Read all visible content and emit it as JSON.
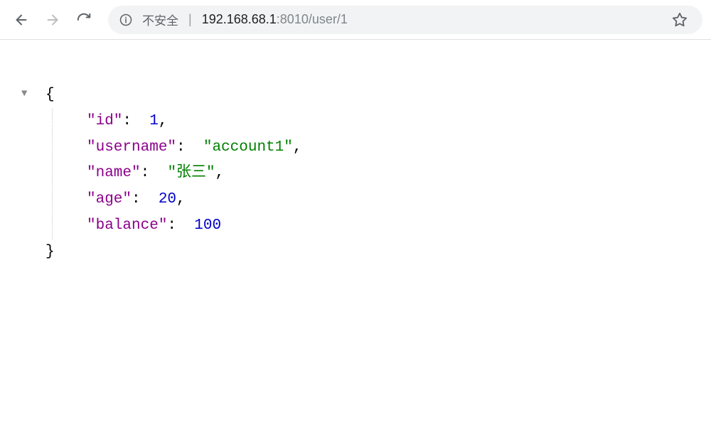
{
  "toolbar": {
    "insecure_label": "不安全",
    "url_host": "192.168.68.1",
    "url_port_path": ":8010/user/1"
  },
  "json": {
    "open_brace": "{",
    "close_brace": "}",
    "entries": [
      {
        "key": "id",
        "type": "number",
        "value": 1,
        "trailing_comma": true
      },
      {
        "key": "username",
        "type": "string",
        "value": "account1",
        "trailing_comma": true
      },
      {
        "key": "name",
        "type": "string",
        "value": "张三",
        "trailing_comma": true
      },
      {
        "key": "age",
        "type": "number",
        "value": 20,
        "trailing_comma": true
      },
      {
        "key": "balance",
        "type": "number",
        "value": 100,
        "trailing_comma": false
      }
    ]
  }
}
